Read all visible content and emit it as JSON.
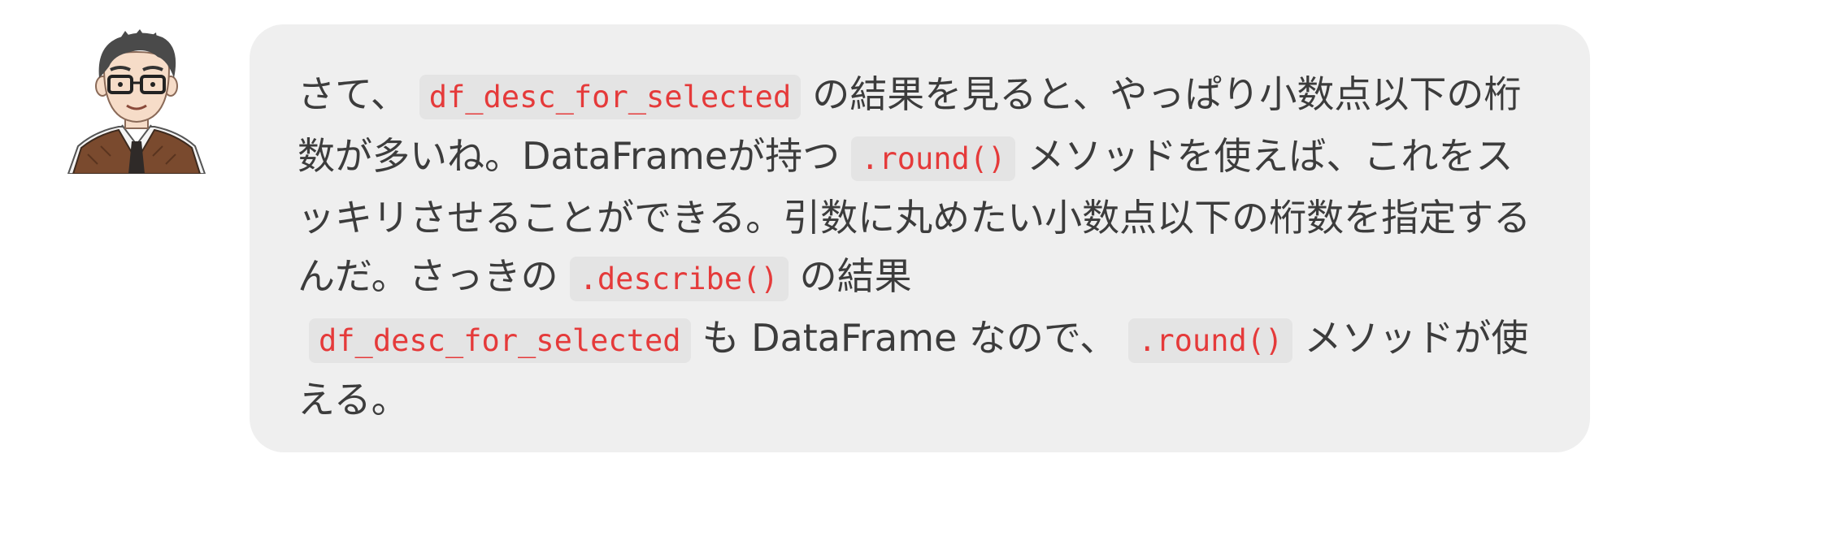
{
  "avatar": {
    "icon": "teacher-avatar-icon",
    "colors": {
      "hair": "#4a4a4a",
      "skin": "#f6dcc8",
      "vest": "#7a4a2e",
      "tie": "#2f2a28",
      "shirt": "#f4f4f4"
    }
  },
  "message": {
    "segments": [
      {
        "type": "text",
        "value": "さて、"
      },
      {
        "type": "code",
        "value": "df_desc_for_selected"
      },
      {
        "type": "text",
        "value": "の結果を見ると、やっぱり小数点以下の桁数が多いね。DataFrameが持つ"
      },
      {
        "type": "code",
        "value": ".round()"
      },
      {
        "type": "text",
        "value": "メソッドを使えば、これをスッキリさせることができる。引数に丸めたい小数点以下の桁数を指定するんだ。さっきの"
      },
      {
        "type": "code",
        "value": ".describe()"
      },
      {
        "type": "text",
        "value": "の結果"
      },
      {
        "type": "code",
        "value": "df_desc_for_selected"
      },
      {
        "type": "text",
        "value": "も DataFrame なので、"
      },
      {
        "type": "code",
        "value": ".round()"
      },
      {
        "type": "text",
        "value": "メソッドが使える。"
      }
    ]
  },
  "colors": {
    "bubble_bg": "#efefef",
    "text": "#3c3c3c",
    "code_text": "#e53a3a",
    "code_bg": "#e4e4e4"
  }
}
